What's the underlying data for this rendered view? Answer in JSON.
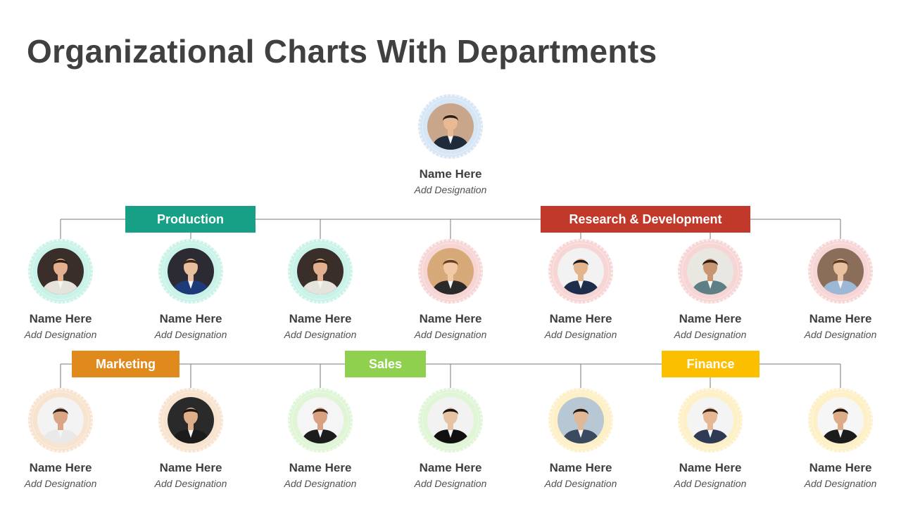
{
  "title": "Organizational Charts With Departments",
  "top": {
    "name": "Name Here",
    "designation": "Add Designation",
    "ring": "#d6e6f5",
    "bg": "#c9a58a",
    "skin": "#e8b994",
    "hair": "#2a1d15",
    "suit": "#1f2a3a"
  },
  "departments": [
    {
      "label": "Production",
      "color": "#17a085"
    },
    {
      "label": "Research & Development",
      "color": "#c0392b"
    },
    {
      "label": "Marketing",
      "color": "#e08a1e"
    },
    {
      "label": "Sales",
      "color": "#8fd14f"
    },
    {
      "label": "Finance",
      "color": "#fbbf00"
    }
  ],
  "row1": [
    {
      "name": "Name Here",
      "designation": "Add Designation",
      "ring": "#c9f3e8",
      "bg": "#3a2e2a",
      "skin": "#e2b08e",
      "hair": "#2b1b12",
      "suit": "#e6e2dc"
    },
    {
      "name": "Name Here",
      "designation": "Add Designation",
      "ring": "#c9f3e8",
      "bg": "#2c2a33",
      "skin": "#e7bf9f",
      "hair": "#3a2616",
      "suit": "#1d3b78"
    },
    {
      "name": "Name Here",
      "designation": "Add Designation",
      "ring": "#c9f3e8",
      "bg": "#3a2e2a",
      "skin": "#e2b08e",
      "hair": "#2b1b12",
      "suit": "#e6e2dc"
    },
    {
      "name": "Name Here",
      "designation": "Add Designation",
      "ring": "#f7d5d5",
      "bg": "#d8a978",
      "skin": "#f1c9a7",
      "hair": "#6b3f23",
      "suit": "#2a2a2a"
    },
    {
      "name": "Name Here",
      "designation": "Add Designation",
      "ring": "#f7d5d5",
      "bg": "#f2f2f2",
      "skin": "#e4b48c",
      "hair": "#1a1a1a",
      "suit": "#1f2d4d"
    },
    {
      "name": "Name Here",
      "designation": "Add Designation",
      "ring": "#f7d5d5",
      "bg": "#e9e7e2",
      "skin": "#c99470",
      "hair": "#2a1d15",
      "suit": "#5d7f85"
    },
    {
      "name": "Name Here",
      "designation": "Add Designation",
      "ring": "#f7d5d5",
      "bg": "#8a6e5a",
      "skin": "#e9c0a0",
      "hair": "#5a3a20",
      "suit": "#9bb8d6"
    }
  ],
  "row2": [
    {
      "name": "Name Here",
      "designation": "Add Designation",
      "ring": "#f8e3cf",
      "bg": "#f3f3f3",
      "skin": "#d9a584",
      "hair": "#2a1f1a",
      "suit": "#e9e9e9"
    },
    {
      "name": "Name Here",
      "designation": "Add Designation",
      "ring": "#f8e3cf",
      "bg": "#2a2a2a",
      "skin": "#deae8a",
      "hair": "#1a120d",
      "suit": "#1c1c1c"
    },
    {
      "name": "Name Here",
      "designation": "Add Designation",
      "ring": "#dff5d6",
      "bg": "#f5f5f5",
      "skin": "#d8a282",
      "hair": "#3a2418",
      "suit": "#1c1c1c"
    },
    {
      "name": "Name Here",
      "designation": "Add Designation",
      "ring": "#dff5d6",
      "bg": "#f2f2f2",
      "skin": "#e8c3a3",
      "hair": "#1a1310",
      "suit": "#111111"
    },
    {
      "name": "Name Here",
      "designation": "Add Designation",
      "ring": "#fdf0c6",
      "bg": "#b7c7d3",
      "skin": "#e0b896",
      "hair": "#1a1a1a",
      "suit": "#3b4a5e"
    },
    {
      "name": "Name Here",
      "designation": "Add Designation",
      "ring": "#fdf0c6",
      "bg": "#f4f4f4",
      "skin": "#e5b792",
      "hair": "#3a2618",
      "suit": "#2f3a55"
    },
    {
      "name": "Name Here",
      "designation": "Add Designation",
      "ring": "#fdf0c6",
      "bg": "#f6f6f6",
      "skin": "#dcab88",
      "hair": "#1a120d",
      "suit": "#1c1c1c"
    }
  ]
}
